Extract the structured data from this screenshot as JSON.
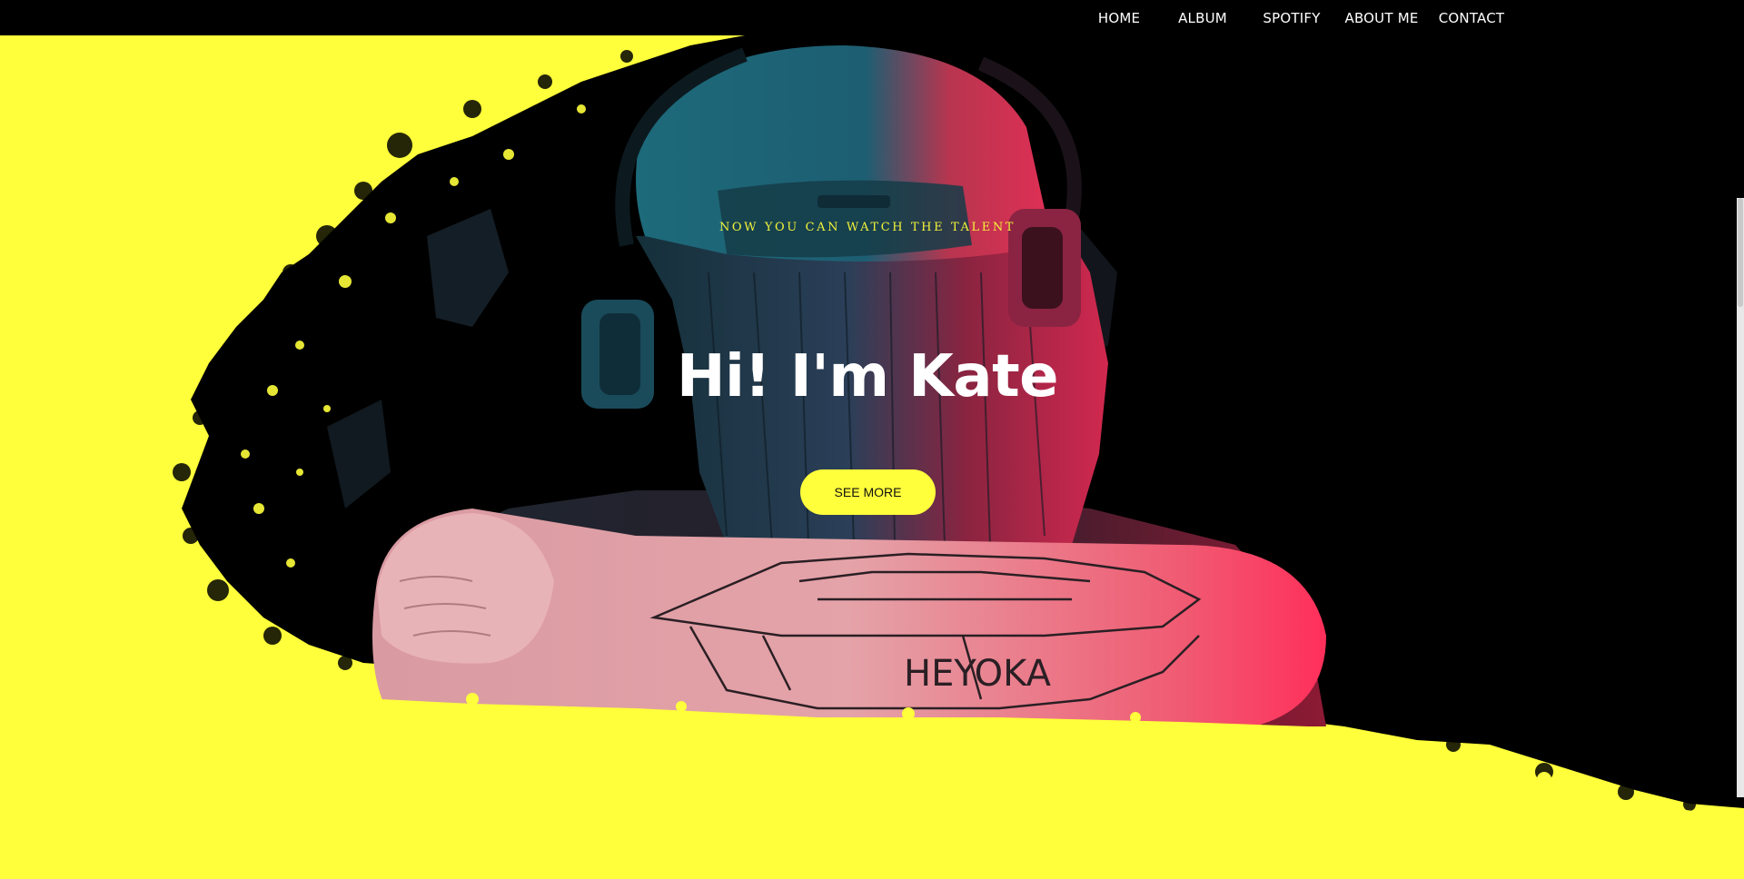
{
  "nav": {
    "items": [
      {
        "label": "HOME"
      },
      {
        "label": "ALBUM"
      },
      {
        "label": "SPOTIFY"
      },
      {
        "label": "ABOUT ME"
      },
      {
        "label": "CONTACT"
      }
    ]
  },
  "hero": {
    "tagline": "NOW YOU CAN WATCH THE TALENT",
    "headline": "Hi! I'm Kate",
    "cta_label": "SEE MORE",
    "image_label": "photo of person from behind wearing cap and headphones with tattooed arm",
    "tattoo_text": "HEYOKA"
  },
  "colors": {
    "accent": "#ffff3b",
    "background": "#000000",
    "text": "#ffffff",
    "cap_teal": "#1f6f80",
    "light_pink": "#ff2f5a"
  }
}
